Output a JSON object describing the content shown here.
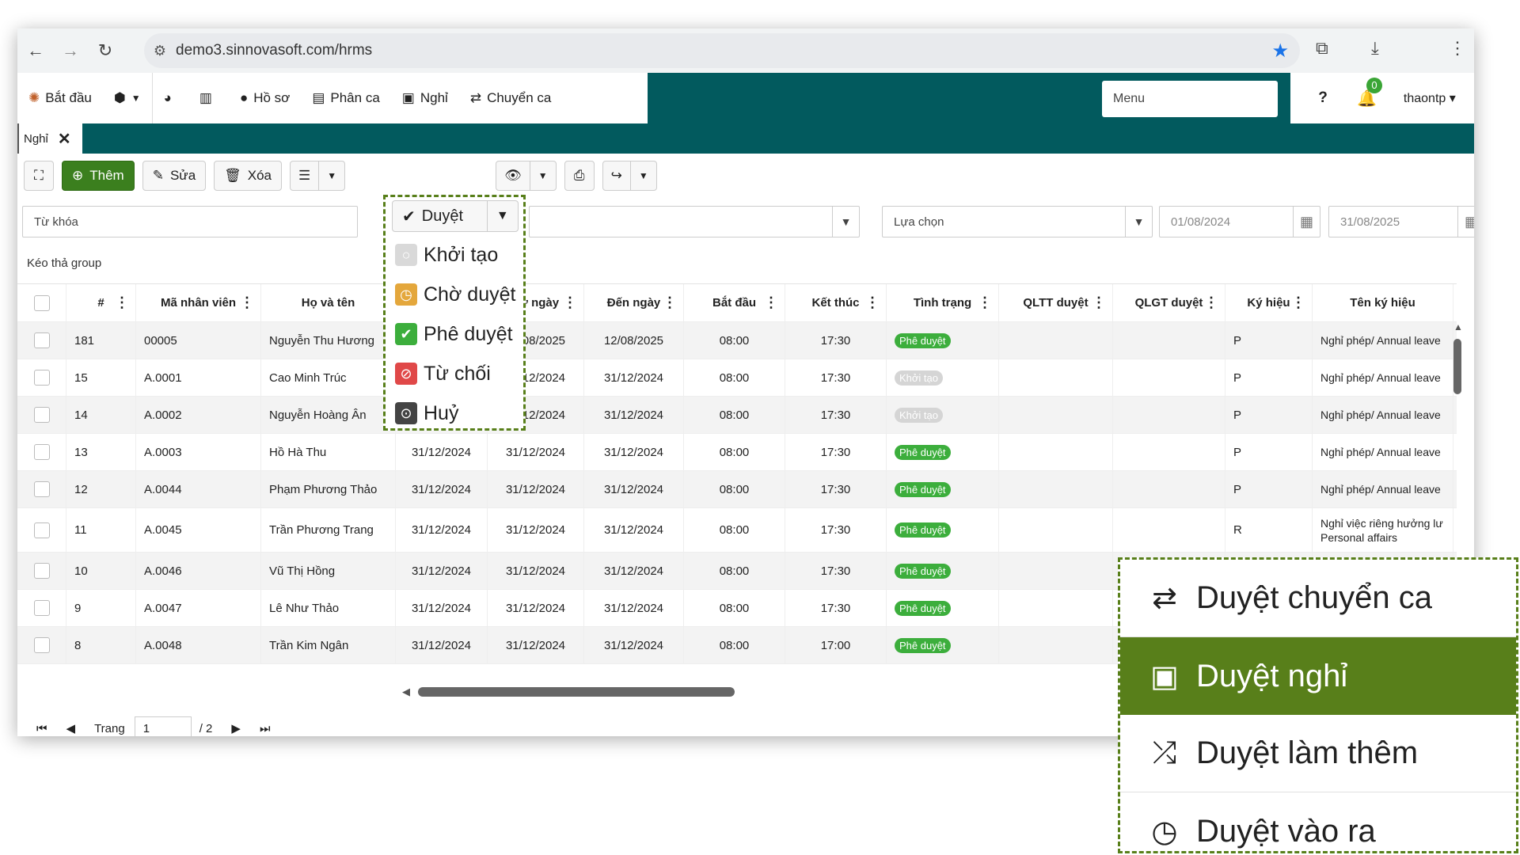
{
  "browser": {
    "url": "demo3.sinnovasoft.com/hrms"
  },
  "topmenu": {
    "start": "Bắt đầu",
    "ho_so": "Hồ sơ",
    "phan_ca": "Phân ca",
    "nghi": "Nghỉ",
    "chuyen_ca": "Chuyển ca",
    "menu_placeholder": "Menu",
    "notification_count": "0",
    "user": "thaontp"
  },
  "tab": {
    "label": "Nghỉ"
  },
  "toolbar": {
    "add": "Thêm",
    "edit": "Sửa",
    "delete": "Xóa",
    "approve": "Duyệt"
  },
  "filters": {
    "keyword_placeholder": "Từ khóa",
    "choice": "Lựa chọn",
    "from_date": "01/08/2024",
    "to_date": "31/08/2025",
    "group_label": "Kéo thả group"
  },
  "approve_menu": {
    "items": [
      "Khởi tạo",
      "Chờ duyệt",
      "Phê duyệt",
      "Từ chối",
      "Huỷ"
    ]
  },
  "grid": {
    "columns": [
      "#",
      "Mã nhân viên",
      "Họ và tên",
      "Từ ngày",
      "Đến ngày",
      "Bắt đầu",
      "Kết thúc",
      "Tình trạng",
      "QLTT duyệt",
      "QLGT duyệt",
      "Ký hiệu",
      "Tên ký hiệu"
    ],
    "rows": [
      {
        "no": "181",
        "code": "00005",
        "name": "Nguyễn Thu Hương",
        "from": "12/08/2025",
        "to": "12/08/2025",
        "start": "08:00",
        "end": "17:30",
        "status": "Phê duyệt",
        "sym": "P",
        "symname": "Nghỉ phép/ Annual leave"
      },
      {
        "no": "15",
        "code": "A.0001",
        "name": "Cao Minh Trúc",
        "from": "31/12/2024",
        "to": "31/12/2024",
        "start": "08:00",
        "end": "17:30",
        "status": "Khởi tạo",
        "sym": "P",
        "symname": "Nghỉ phép/ Annual leave"
      },
      {
        "no": "14",
        "code": "A.0002",
        "name": "Nguyễn Hoàng Ân",
        "from": "31/12/2024",
        "to": "31/12/2024",
        "start": "08:00",
        "end": "17:30",
        "status": "Khởi tạo",
        "sym": "P",
        "symname": "Nghỉ phép/ Annual leave"
      },
      {
        "no": "13",
        "code": "A.0003",
        "name": "Hồ Hà Thu",
        "from": "31/12/2024",
        "to": "31/12/2024",
        "start": "08:00",
        "end": "17:30",
        "status": "Phê duyệt",
        "sym": "P",
        "symname": "Nghỉ phép/ Annual leave"
      },
      {
        "no": "12",
        "code": "A.0044",
        "name": "Phạm Phương Thảo",
        "from": "31/12/2024",
        "to": "31/12/2024",
        "start": "08:00",
        "end": "17:30",
        "status": "Phê duyệt",
        "sym": "P",
        "symname": "Nghỉ phép/ Annual leave"
      },
      {
        "no": "11",
        "code": "A.0045",
        "name": "Trần Phương Trang",
        "from": "31/12/2024",
        "to": "31/12/2024",
        "start": "08:00",
        "end": "17:30",
        "status": "Phê duyệt",
        "sym": "R",
        "symname": "Nghỉ việc riêng hưởng lư",
        "symname2": "Personal affairs"
      },
      {
        "no": "10",
        "code": "A.0046",
        "name": "Vũ Thị Hồng",
        "from": "31/12/2024",
        "to": "31/12/2024",
        "start": "08:00",
        "end": "17:30",
        "status": "Phê duyệt",
        "sym": "",
        "symname": ""
      },
      {
        "no": "9",
        "code": "A.0047",
        "name": "Lê Như Thảo",
        "from": "31/12/2024",
        "to": "31/12/2024",
        "start": "08:00",
        "end": "17:30",
        "status": "Phê duyệt",
        "sym": "",
        "symname": ""
      },
      {
        "no": "8",
        "code": "A.0048",
        "name": "Trần Kim Ngân",
        "from": "31/12/2024",
        "to": "31/12/2024",
        "start": "08:00",
        "end": "17:00",
        "status": "Phê duyệt",
        "sym": "",
        "symname": ""
      }
    ]
  },
  "pager": {
    "label": "Trang",
    "page": "1",
    "total": "/ 2"
  },
  "callout": {
    "items": [
      "Duyệt chuyển ca",
      "Duyệt nghỉ",
      "Duyệt làm thêm",
      "Duyệt vào ra"
    ]
  },
  "colors": {
    "header_teal": "#025a5e",
    "brand_green": "#587f1a",
    "approved_pill": "#3cae3c"
  }
}
